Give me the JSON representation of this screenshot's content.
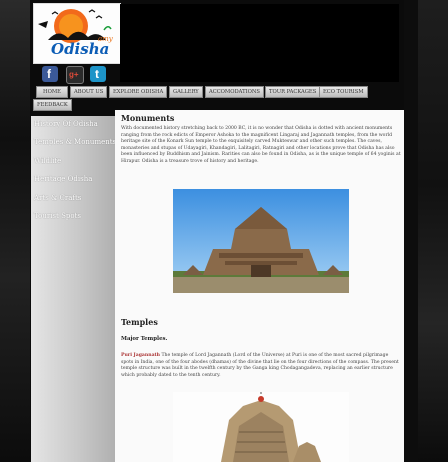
{
  "logo": {
    "text": "Odisha",
    "tag": "amy"
  },
  "social": [
    {
      "name": "facebook",
      "icon": "f"
    },
    {
      "name": "google-plus",
      "icon": "g+"
    },
    {
      "name": "twitter",
      "icon": "t"
    }
  ],
  "nav": {
    "items": [
      {
        "label": "HOME",
        "active": true
      },
      {
        "label": "ABOUT US"
      },
      {
        "label": "EXPLORE ODISHA"
      },
      {
        "label": "GALLERY"
      },
      {
        "label": "ACCOMODATIONS"
      },
      {
        "label": "TOUR PACKAGES"
      },
      {
        "label": "ECO TOURISM"
      },
      {
        "label": "FEEDBACK"
      }
    ]
  },
  "sidebar": {
    "items": [
      {
        "label": "History Of Odisha"
      },
      {
        "label": "Temples & Monuments"
      },
      {
        "label": "Wildlife"
      },
      {
        "label": "Heritage Odisha"
      },
      {
        "label": "Arts & Crafts"
      },
      {
        "label": "Tourist Spots"
      }
    ]
  },
  "content": {
    "monuments_title": "Monuments",
    "monuments_text": "With documented history stretching back to 2000 BC, it is no wonder that Odisha is dotted with ancient monuments ranging from the rock edicts of Emperor Ashoka to the magnificent Lingaraj and Jagannath temples, from the world heritage site of the Konark Sun temple to the exquisitely carved Mukteswar and other such temples. The caves, monasteries and stupas of Udayagiri, Khandagiri, Lalitagiri, Ratnagiri and other locations prove that Odisha has also been influenced by Buddhism and Jainism. Rarities can also be found in Odisha, as is the unique temple of 64 yoginis at Hirapur. Odisha is a treasure trove of history and heritage.",
    "temples_title": "Temples",
    "major_temples": "Major Temples.",
    "puri_label": "Puri Jagannath",
    "puri_text": "The temple of Lord Jagannath (Lord of the Universe) at Puri is one of the most sacred pilgrimage spots in India, one of the four abodes (dhamas) of the divine that lie on the four directions of the compass. The present temple structure was built in the twelfth century by the Ganga king Chodagangadeva, replacing an earlier structure which probably dated to the tenth century."
  }
}
